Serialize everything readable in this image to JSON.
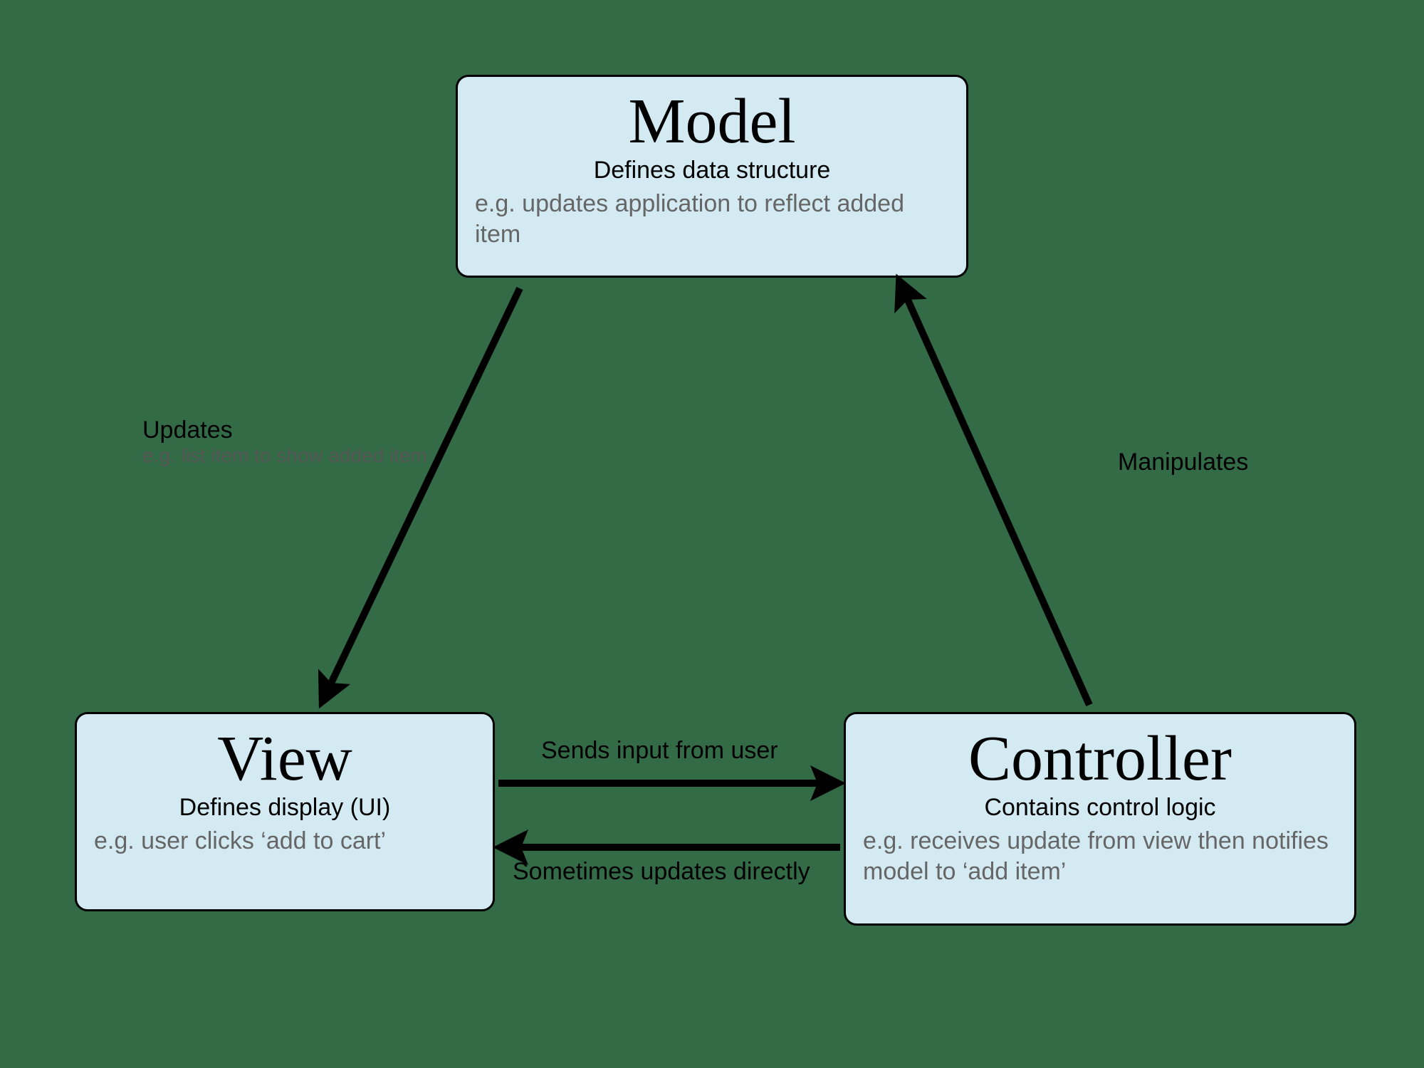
{
  "nodes": {
    "model": {
      "title": "Model",
      "subtitle": "Defines data structure",
      "example": "e.g. updates application to reflect added item"
    },
    "view": {
      "title": "View",
      "subtitle": "Defines display (UI)",
      "example": "e.g. user clicks ‘add to cart’"
    },
    "controller": {
      "title": "Controller",
      "subtitle": "Contains control logic",
      "example": "e.g. receives update from view then notifies model to ‘add item’"
    }
  },
  "edges": {
    "model_to_view": {
      "main": "Updates",
      "sub": "e.g. list item to show added item"
    },
    "controller_to_model": {
      "main": "Manipulates"
    },
    "view_to_controller": {
      "main": "Sends input from user"
    },
    "controller_to_view": {
      "main": "Sometimes updates directly"
    }
  },
  "colors": {
    "background": "#346b47",
    "box_fill": "#d3eaf2",
    "box_border": "#000000",
    "arrow": "#000000",
    "text_primary": "#000000",
    "text_secondary": "#666666"
  }
}
